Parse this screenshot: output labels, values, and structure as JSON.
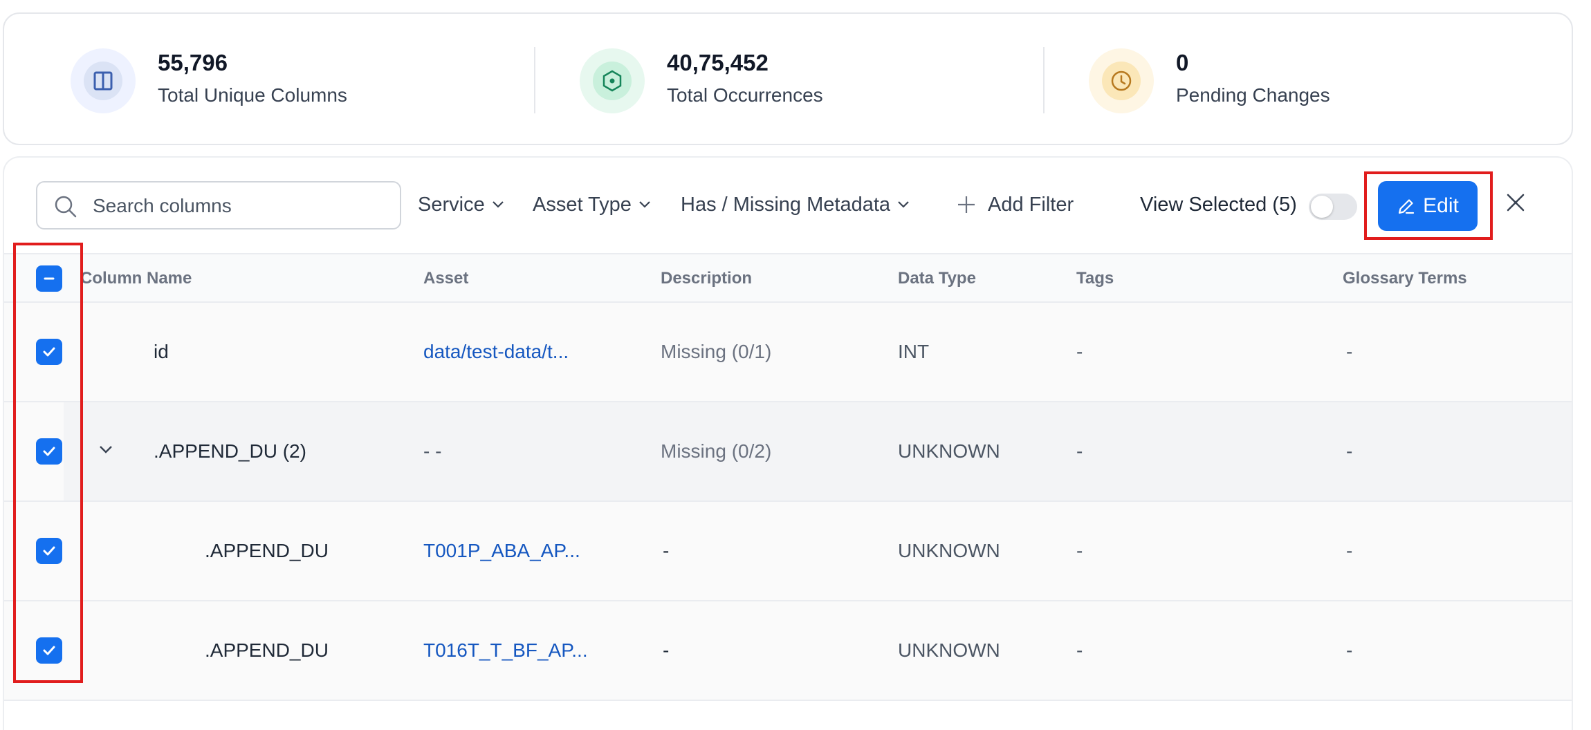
{
  "stats": [
    {
      "value": "55,796",
      "label": "Total Unique Columns",
      "icon": "columns-icon",
      "bg": "#eef2ff",
      "inner": "#dbe3f5",
      "fg": "#3b5fae"
    },
    {
      "value": "40,75,452",
      "label": "Total Occurrences",
      "icon": "target-icon",
      "bg": "#e7f8ef",
      "inner": "#c9f0dc",
      "fg": "#16855a"
    },
    {
      "value": "0",
      "label": "Pending Changes",
      "icon": "clock-icon",
      "bg": "#fef6e4",
      "inner": "#fbe7b8",
      "fg": "#b7791f"
    }
  ],
  "toolbar": {
    "search_placeholder": "Search columns",
    "filters": [
      "Service",
      "Asset Type",
      "Has / Missing Metadata"
    ],
    "add_filter": "Add Filter",
    "view_selected": "View Selected (5)",
    "edit": "Edit"
  },
  "table": {
    "headers": [
      "Column Name",
      "Asset",
      "Description",
      "Data Type",
      "Tags",
      "Glossary Terms"
    ],
    "rows": [
      {
        "name": "id",
        "asset": "data/test-data/t...",
        "description": "Missing (0/1)",
        "type": "INT",
        "tags": "-",
        "glossary": "-"
      },
      {
        "name": ".APPEND_DU (2)",
        "asset": "- -",
        "description": "Missing (0/2)",
        "type": "UNKNOWN",
        "tags": "-",
        "glossary": "-"
      },
      {
        "name": ".APPEND_DU",
        "asset": "T001P_ABA_AP...",
        "description": "-",
        "type": "UNKNOWN",
        "tags": "-",
        "glossary": "-"
      },
      {
        "name": ".APPEND_DU",
        "asset": "T016T_T_BF_AP...",
        "description": "-",
        "type": "UNKNOWN",
        "tags": "-",
        "glossary": "-"
      }
    ]
  },
  "colors": {
    "accent": "#1570ef",
    "highlight": "#e11d1d",
    "link": "#1557c0"
  }
}
